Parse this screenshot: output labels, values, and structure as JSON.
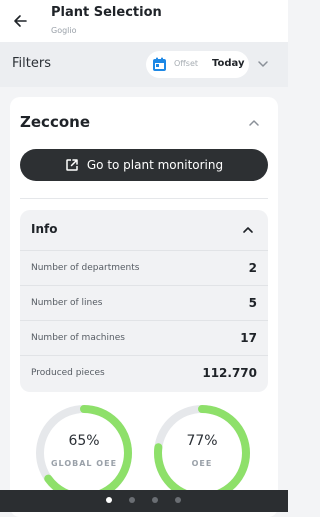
{
  "appbar": {
    "title": "Plant Selection",
    "subtitle": "Goglio",
    "back_icon": "arrow-left-icon"
  },
  "filterbar": {
    "label": "Filters",
    "offset_label": "Offset",
    "date_value": "Today",
    "calendar_icon": "calendar-icon",
    "chevron_icon": "chevron-down-icon"
  },
  "plant": {
    "name": "Zeccone",
    "monitor_button_label": "Go to plant monitoring",
    "monitor_icon": "open-external-icon"
  },
  "info": {
    "title": "Info",
    "rows": [
      {
        "label": "Number of departments",
        "value": "2"
      },
      {
        "label": "Number of lines",
        "value": "5"
      },
      {
        "label": "Number of machines",
        "value": "17"
      },
      {
        "label": "Produced pieces",
        "value": "112.770"
      }
    ]
  },
  "gauges": [
    {
      "value": "65%",
      "fraction": 0.65,
      "label": "GLOBAL OEE"
    },
    {
      "value": "77%",
      "fraction": 0.77,
      "label": "OEE"
    }
  ],
  "pager": {
    "count": 4,
    "active": 0
  },
  "colors": {
    "gauge_fill": "#8ee06a",
    "gauge_track": "#e6e8eb",
    "button_bg": "#2d3033",
    "accent_blue": "#1e88e5"
  }
}
